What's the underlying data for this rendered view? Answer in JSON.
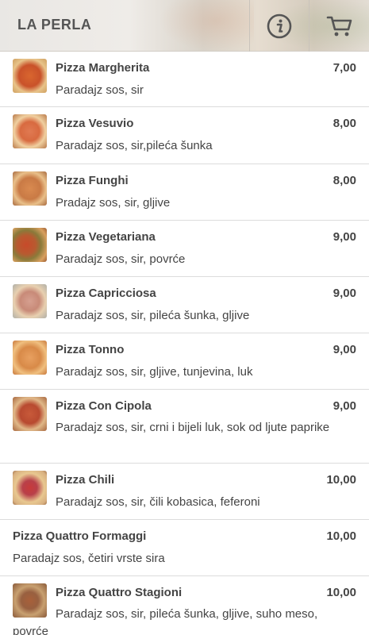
{
  "header": {
    "brand": "LA PERLA",
    "info_icon": "info-icon",
    "cart_icon": "cart-icon"
  },
  "menu": [
    {
      "name": "Pizza Margherita",
      "price": "7,00",
      "desc": "Paradajz sos, sir",
      "image": true
    },
    {
      "name": "Pizza Vesuvio",
      "price": "8,00",
      "desc": "Paradajz sos, sir,pileća šunka",
      "image": true
    },
    {
      "name": "Pizza Funghi",
      "price": "8,00",
      "desc": "Pradajz sos, sir, gljive",
      "image": true
    },
    {
      "name": "Pizza Vegetariana",
      "price": "9,00",
      "desc": "Paradajz sos, sir, povrće",
      "image": true
    },
    {
      "name": "Pizza Capricciosa",
      "price": "9,00",
      "desc": "Paradajz sos, sir, pileća šunka, gljive",
      "image": true
    },
    {
      "name": "Pizza Tonno",
      "price": "9,00",
      "desc": "Paradajz sos, sir, gljive, tunjevina, luk",
      "image": true
    },
    {
      "name": "Pizza Con Cipola",
      "price": "9,00",
      "desc": "Paradajz sos, sir, crni i bijeli luk, sok od ljute paprike",
      "image": true
    },
    {
      "name": "Pizza Chili",
      "price": "10,00",
      "desc": "Paradajz sos, sir, čili kobasica, feferoni",
      "image": true
    },
    {
      "name": "Pizza Quattro Formaggi",
      "price": "10,00",
      "desc": "Paradajz sos, četiri vrste sira",
      "image": false
    },
    {
      "name": "Pizza Quattro Stagioni",
      "price": "10,00",
      "desc": "Paradajz sos, sir, pileća šunka, gljive, suho meso, povrće",
      "image": true
    }
  ],
  "colors": {
    "text": "#444444",
    "divider": "#dcdcdc",
    "header_icon": "#555555"
  }
}
